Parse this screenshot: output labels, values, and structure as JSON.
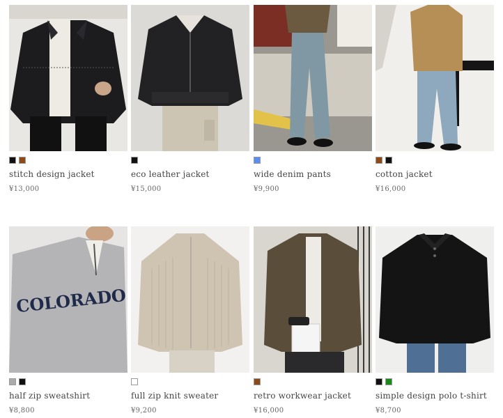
{
  "products": [
    {
      "name": "stitch design jacket",
      "price": "¥13,000",
      "colors": [
        "#111111",
        "#8a4a1a"
      ],
      "photo": "black-jacket"
    },
    {
      "name": "eco leather jacket",
      "price": "¥15,000",
      "colors": [
        "#111111"
      ],
      "photo": "leather-jacket"
    },
    {
      "name": "wide denim pants",
      "price": "¥9,900",
      "colors": [
        "#5b8df0"
      ],
      "photo": "denim-pants"
    },
    {
      "name": "cotton jacket",
      "price": "¥16,000",
      "colors": [
        "#8a4a1a",
        "#111111"
      ],
      "photo": "cotton-jacket"
    },
    {
      "name": "half zip sweatshirt",
      "price": "¥8,800",
      "colors": [
        "#aaaaaa",
        "#111111"
      ],
      "photo": "half-zip-sweatshirt",
      "print_text": "COLORADO"
    },
    {
      "name": "full zip knit sweater",
      "price": "¥9,200",
      "colors": [
        "#ffffff"
      ],
      "photo": "knit-sweater"
    },
    {
      "name": "retro workwear jacket",
      "price": "¥16,000",
      "colors": [
        "#8a4a1a"
      ],
      "photo": "workwear-jacket"
    },
    {
      "name": "simple design polo t-shirt",
      "price": "¥8,700",
      "colors": [
        "#111111",
        "#1a8a1a"
      ],
      "photo": "polo-shirt"
    }
  ]
}
